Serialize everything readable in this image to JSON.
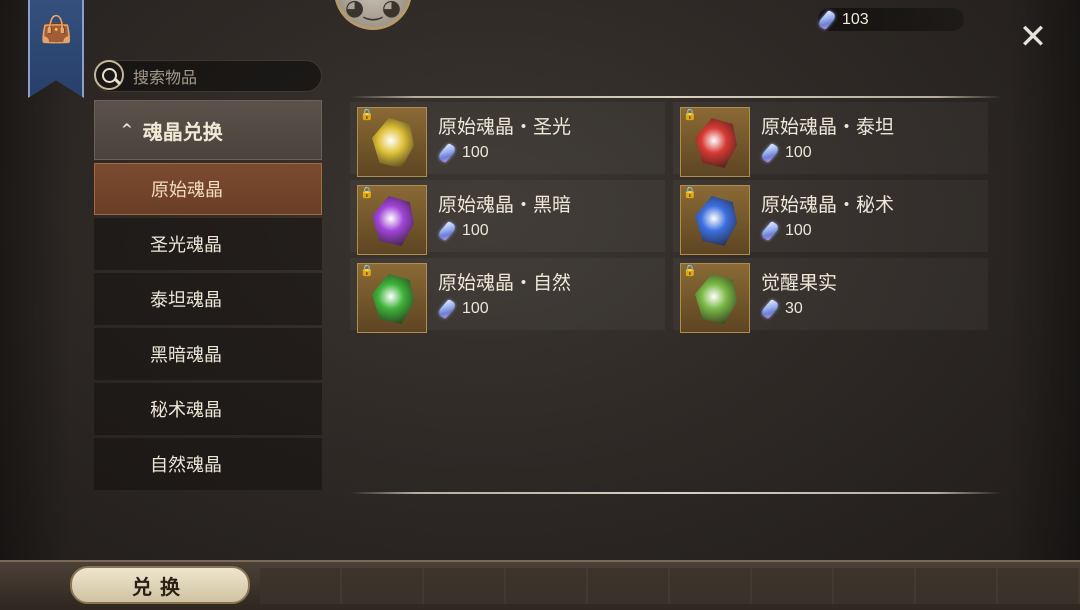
{
  "top": {
    "currency_amount": "103",
    "currency_icon": "soul-crystal-icon",
    "close_label": "✕"
  },
  "search": {
    "placeholder": "搜索物品"
  },
  "sidebar": {
    "category_label": "魂晶兑换",
    "items": [
      {
        "label": "原始魂晶",
        "active": true
      },
      {
        "label": "圣光魂晶",
        "active": false
      },
      {
        "label": "泰坦魂晶",
        "active": false
      },
      {
        "label": "黑暗魂晶",
        "active": false
      },
      {
        "label": "秘术魂晶",
        "active": false
      },
      {
        "label": "自然魂晶",
        "active": false
      }
    ]
  },
  "shop_items": [
    {
      "name": "原始魂晶・圣光",
      "price": "100",
      "color": "#e0c23a",
      "locked": true
    },
    {
      "name": "原始魂晶・泰坦",
      "price": "100",
      "color": "#d63a33",
      "locked": true
    },
    {
      "name": "原始魂晶・黑暗",
      "price": "100",
      "color": "#a144d8",
      "locked": true
    },
    {
      "name": "原始魂晶・秘术",
      "price": "100",
      "color": "#3d6fe0",
      "locked": true
    },
    {
      "name": "原始魂晶・自然",
      "price": "100",
      "color": "#3fb33a",
      "locked": true
    },
    {
      "name": "觉醒果实",
      "price": "30",
      "color": "#7ab845",
      "locked": true
    }
  ],
  "bottom": {
    "exchange_label": "兑换"
  }
}
